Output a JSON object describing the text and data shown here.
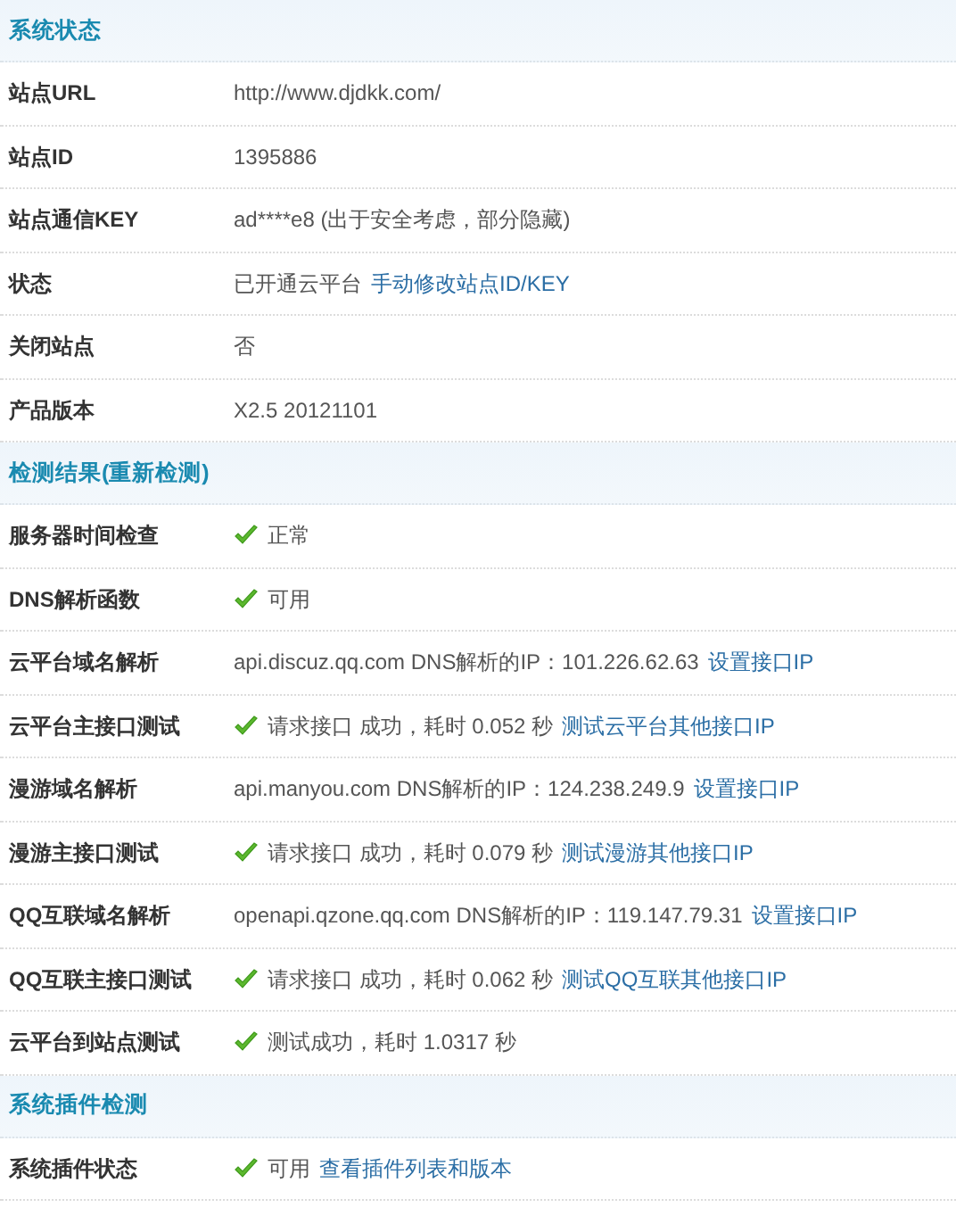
{
  "sections": [
    {
      "title": "系统状态",
      "rows": [
        {
          "label": "站点URL",
          "check": false,
          "value": "http://www.djdkk.com/"
        },
        {
          "label": "站点ID",
          "check": false,
          "value": "1395886"
        },
        {
          "label": "站点通信KEY",
          "check": false,
          "value": "ad****e8 (出于安全考虑，部分隐藏)"
        },
        {
          "label": "状态",
          "check": false,
          "value": "已开通云平台",
          "link": "手动修改站点ID/KEY"
        },
        {
          "label": "关闭站点",
          "check": false,
          "value": "否"
        },
        {
          "label": "产品版本",
          "check": false,
          "value": "X2.5 20121101"
        }
      ]
    },
    {
      "title": "检测结果(重新检测)",
      "rows": [
        {
          "label": "服务器时间检查",
          "check": true,
          "value": "正常"
        },
        {
          "label": "DNS解析函数",
          "check": true,
          "value": "可用"
        },
        {
          "label": "云平台域名解析",
          "check": false,
          "value": "api.discuz.qq.com DNS解析的IP：101.226.62.63",
          "link": "设置接口IP"
        },
        {
          "label": "云平台主接口测试",
          "check": true,
          "value": "请求接口 成功，耗时 0.052 秒",
          "link": "测试云平台其他接口IP"
        },
        {
          "label": "漫游域名解析",
          "check": false,
          "value": "api.manyou.com DNS解析的IP：124.238.249.9",
          "link": "设置接口IP"
        },
        {
          "label": "漫游主接口测试",
          "check": true,
          "value": "请求接口 成功，耗时 0.079 秒",
          "link": "测试漫游其他接口IP"
        },
        {
          "label": "QQ互联域名解析",
          "check": false,
          "value": "openapi.qzone.qq.com DNS解析的IP：119.147.79.31",
          "link": "设置接口IP"
        },
        {
          "label": "QQ互联主接口测试",
          "check": true,
          "value": "请求接口 成功，耗时 0.062 秒",
          "link": "测试QQ互联其他接口IP"
        },
        {
          "label": "云平台到站点测试",
          "check": true,
          "value": "测试成功，耗时 1.0317 秒"
        }
      ]
    },
    {
      "title": "系统插件检测",
      "rows": [
        {
          "label": "系统插件状态",
          "check": true,
          "value": "可用",
          "link": "查看插件列表和版本"
        }
      ]
    }
  ]
}
